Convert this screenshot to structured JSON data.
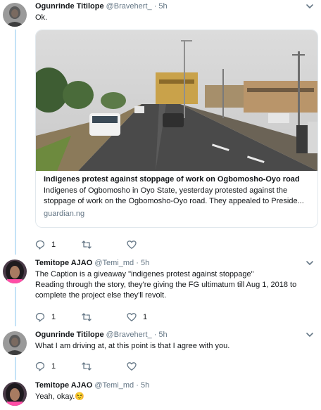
{
  "thread": [
    {
      "name": "Ogunrinde Titilope",
      "handle": "@Bravehert_",
      "separator": "·",
      "time": "5h",
      "text": [
        "Ok."
      ],
      "card": {
        "title": "Indigenes protest against stoppage of work on Ogbomosho-Oyo road",
        "description": "Indigenes of Ogbomosho in Oyo State, yesterday protested against the stoppage of work on the Ogbomosho-Oyo road. They appealed to Preside...",
        "domain": "guardian.ng"
      },
      "actions": {
        "reply_count": "1",
        "retweet_count": "",
        "like_count": ""
      }
    },
    {
      "name": "Temitope AJAO",
      "handle": "@Temi_md",
      "separator": "·",
      "time": "5h",
      "text": [
        "The Caption is a giveaway \"indigenes protest  against stoppage\"",
        "Reading through the story, they're giving the FG ultimatum till Aug 1, 2018 to",
        "complete the project else they'll revolt."
      ],
      "actions": {
        "reply_count": "1",
        "retweet_count": "",
        "like_count": "1"
      }
    },
    {
      "name": "Ogunrinde Titilope",
      "handle": "@Bravehert_",
      "separator": "·",
      "time": "5h",
      "text": [
        "What I am driving at, at this point is that I agree with you."
      ],
      "actions": {
        "reply_count": "1",
        "retweet_count": "",
        "like_count": ""
      }
    },
    {
      "name": "Temitope AJAO",
      "handle": "@Temi_md",
      "separator": "·",
      "time": "5h",
      "text": [
        "Yeah, okay.☺️"
      ]
    }
  ],
  "icons": {
    "reply": "reply-icon",
    "retweet": "retweet-icon",
    "like": "heart-icon",
    "more": "chevron-down-icon"
  },
  "colors": {
    "thread_line": "#c4e3f7",
    "secondary_text": "#657786",
    "border": "#e1e8ed"
  }
}
